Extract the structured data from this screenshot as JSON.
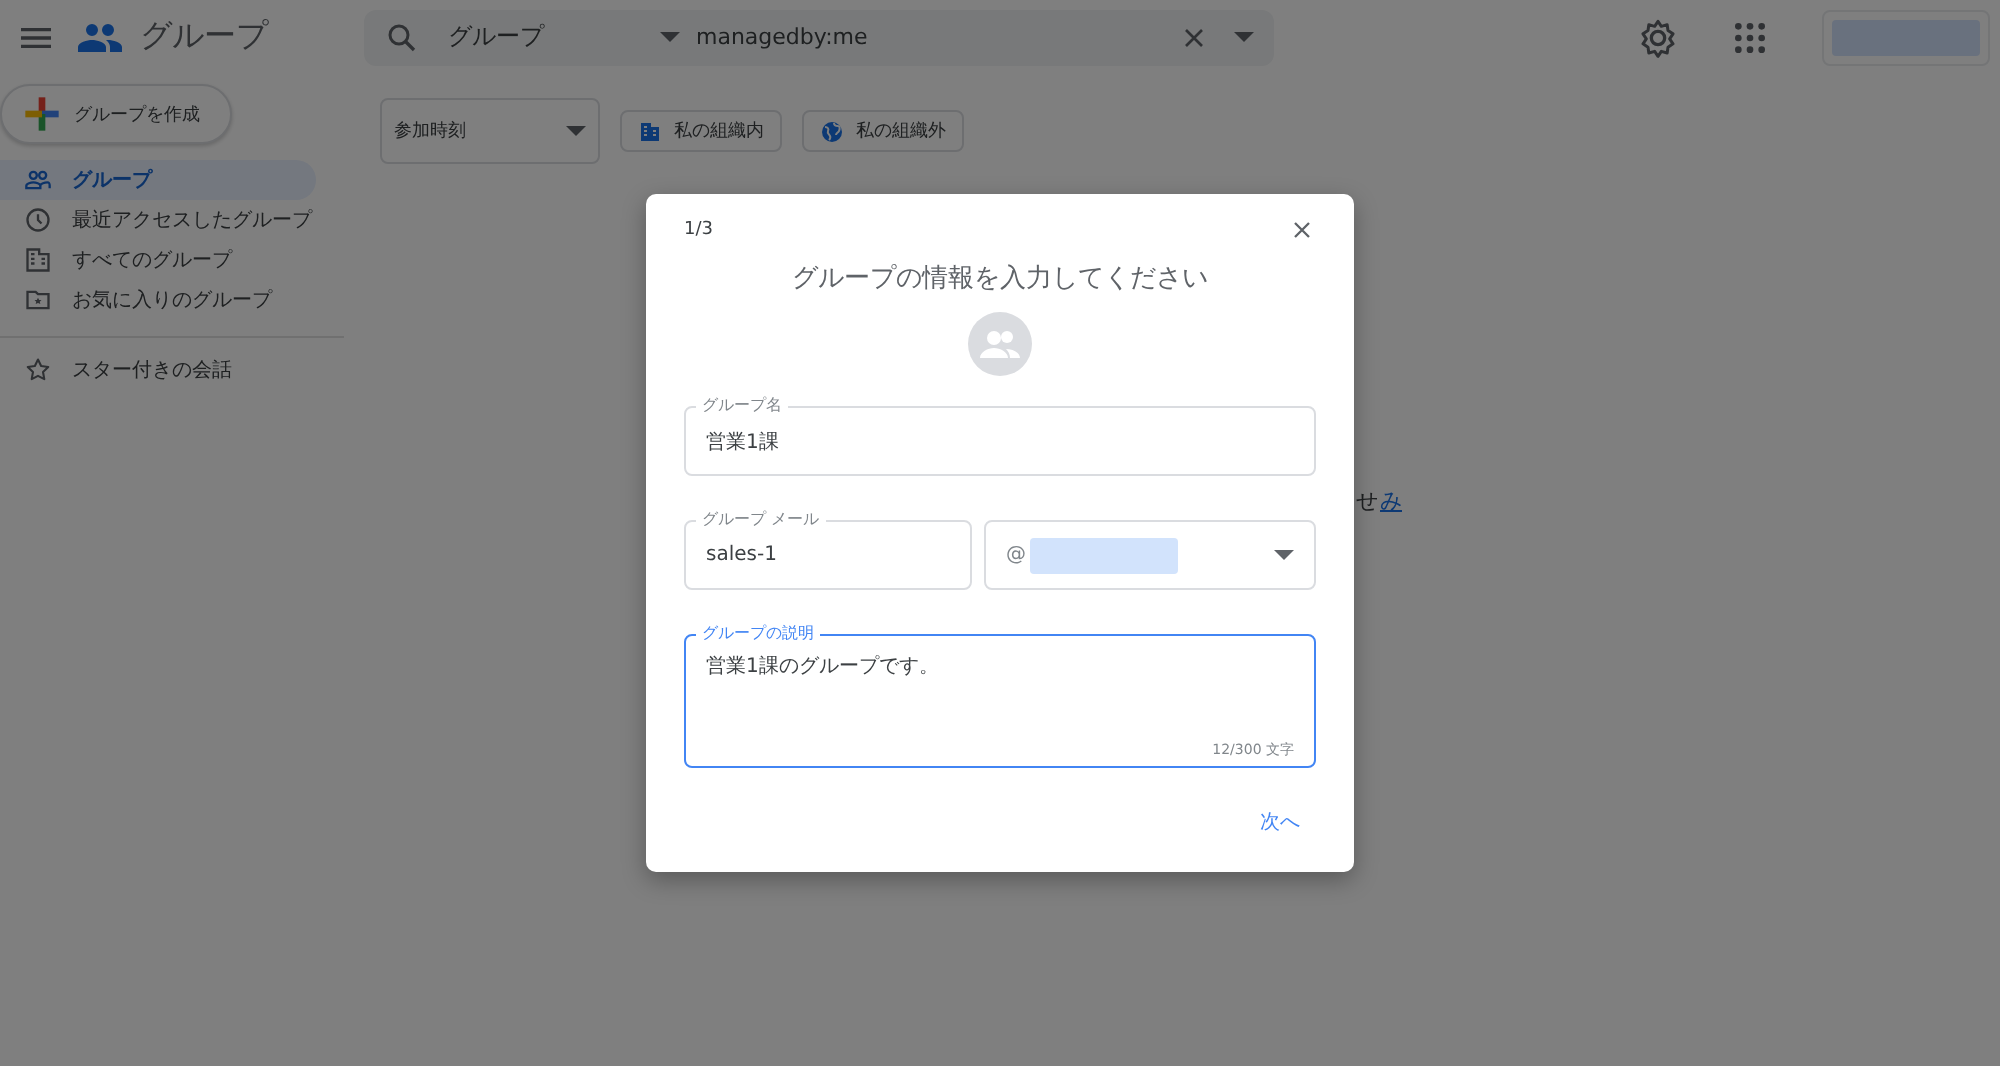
{
  "app_bar": {
    "title": "グループ",
    "search": {
      "scope": "グループ",
      "query": "managedby:me"
    }
  },
  "create_button": {
    "label": "グループを作成"
  },
  "nav": [
    {
      "label": "グループ",
      "selected": true
    },
    {
      "label": "最近アクセスしたグループ",
      "selected": false
    },
    {
      "label": "すべてのグループ",
      "selected": false
    },
    {
      "label": "お気に入りのグループ",
      "selected": false
    }
  ],
  "nav_secondary": [
    {
      "label": "スター付きの会話",
      "selected": false
    }
  ],
  "filters": {
    "sort": "参加時刻",
    "chips": [
      {
        "label": "私の組織内"
      },
      {
        "label": "私の組織外"
      }
    ]
  },
  "background_text": [
    {
      "kind": "text",
      "text": "せ"
    },
    {
      "kind": "link",
      "text": "み"
    }
  ],
  "dialog": {
    "step": "1/3",
    "title": "グループの情報を入力してください",
    "name_field": {
      "label": "グループ名",
      "value": "営業1課",
      "focused": false
    },
    "email_field": {
      "label": "グループ メール",
      "value": "sales-1",
      "domain_prefix": "@",
      "focused": false
    },
    "description_field": {
      "label": "グループの説明",
      "value": "営業1課のグループです。",
      "counter": "12/300 文字",
      "focused": true
    },
    "next_button": "次へ"
  }
}
